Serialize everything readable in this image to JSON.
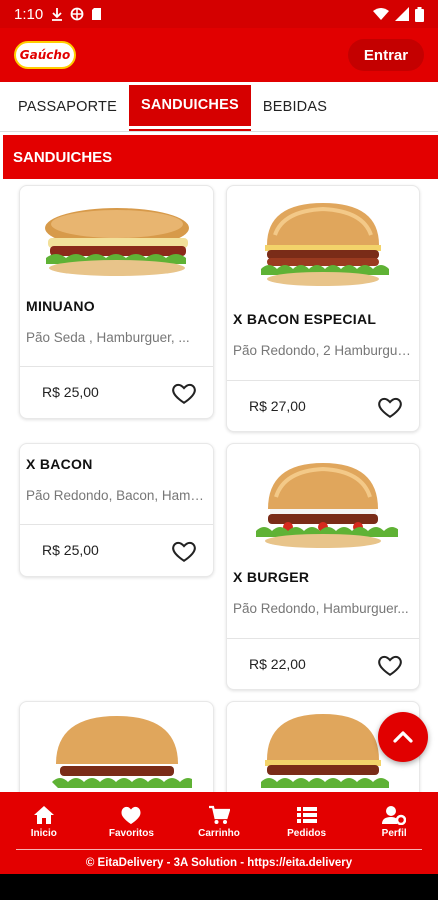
{
  "status_bar": {
    "time": "1:10"
  },
  "app_bar": {
    "logo_text": "Gaúcho",
    "login_label": "Entrar"
  },
  "tabs": [
    {
      "label": "PASSAPORTE",
      "active": false
    },
    {
      "label": "SANDUICHES",
      "active": true
    },
    {
      "label": "BEBIDAS",
      "active": false
    }
  ],
  "section": {
    "title": "SANDUICHES"
  },
  "products": [
    {
      "name": "MINUANO",
      "description": "Pão Seda , Hamburguer, ...",
      "price": "R$ 25,00",
      "has_image": true
    },
    {
      "name": "X BACON ESPECIAL",
      "description": "Pão Redondo, 2 Hamburguer...",
      "price": "R$ 27,00",
      "has_image": true
    },
    {
      "name": "X BACON",
      "description": "Pão Redondo, Bacon, Hambu...",
      "price": "R$ 25,00",
      "has_image": false
    },
    {
      "name": "X BURGER",
      "description": "Pão Redondo, Hamburguer...",
      "price": "R$ 22,00",
      "has_image": true
    }
  ],
  "bottom_nav": [
    {
      "label": "Inicio",
      "icon": "home-icon"
    },
    {
      "label": "Favoritos",
      "icon": "heart-icon"
    },
    {
      "label": "Carrinho",
      "icon": "cart-icon"
    },
    {
      "label": "Pedidos",
      "icon": "list-icon"
    },
    {
      "label": "Perfil",
      "icon": "profile-settings-icon"
    }
  ],
  "footer": {
    "text": "© EitaDelivery - 3A Solution - https://eita.delivery"
  },
  "colors": {
    "brand_red": "#e30000",
    "status_red": "#d40000",
    "white": "#ffffff"
  }
}
